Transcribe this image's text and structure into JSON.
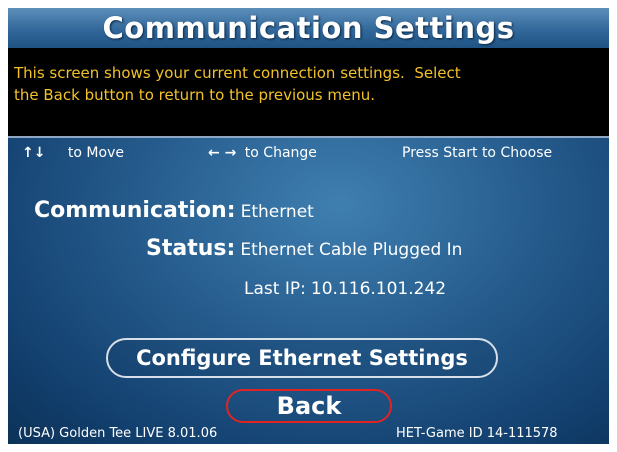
{
  "header": {
    "title": "Communication Settings"
  },
  "info": {
    "line1": "This screen shows your current connection settings.  Select",
    "line2": "the Back button to return to the previous menu."
  },
  "controls": {
    "move": {
      "icon": "up-down-arrows-icon",
      "arrows": "↑↓",
      "label": "to Move"
    },
    "change": {
      "icon": "left-right-arrows-icon",
      "arrows": "← →",
      "label": "to Change"
    },
    "choose": {
      "label": "Press Start to Choose"
    }
  },
  "status": {
    "communication_label": "Communication:",
    "communication_value": "Ethernet",
    "status_label": "Status:",
    "status_value": "Ethernet Cable Plugged In",
    "last_ip_label": "Last IP:",
    "last_ip_value": "10.116.101.242"
  },
  "buttons": {
    "configure": "Configure Ethernet Settings",
    "back": "Back"
  },
  "footer": {
    "left": "(USA) Golden Tee LIVE 8.01.06",
    "right": "HET-Game ID 14-111578"
  },
  "colors": {
    "info_text": "#f3c12a",
    "back_outline": "#e02424",
    "background": "#245a8b"
  }
}
